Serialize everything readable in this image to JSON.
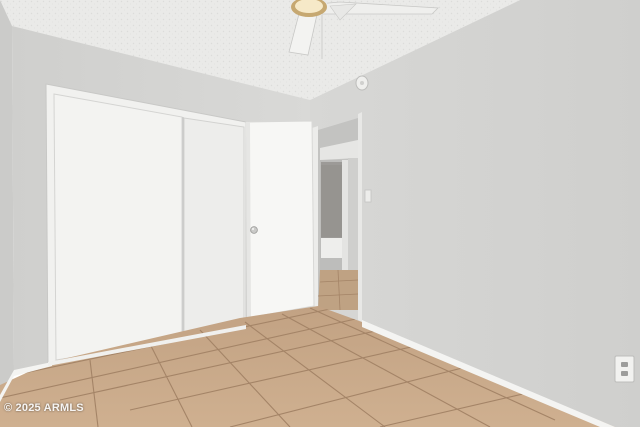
{
  "photo": {
    "subject": "empty-bedroom",
    "watermark": "© 2025 ARMLS"
  },
  "palette": {
    "wall": "#d6d6d4",
    "wall_right": "#d2d2d0",
    "ceiling": "#ececea",
    "closet_door": "#f3f3f1",
    "door": "#f7f7f5",
    "floor_tile": "#c9ab8c",
    "grout": "#a48467",
    "baseboard": "#f4f4f2"
  },
  "icons": [
    "ceiling-fan-icon",
    "smoke-detector-icon",
    "door-knob-icon",
    "outlet-icon",
    "light-switch-icon"
  ]
}
